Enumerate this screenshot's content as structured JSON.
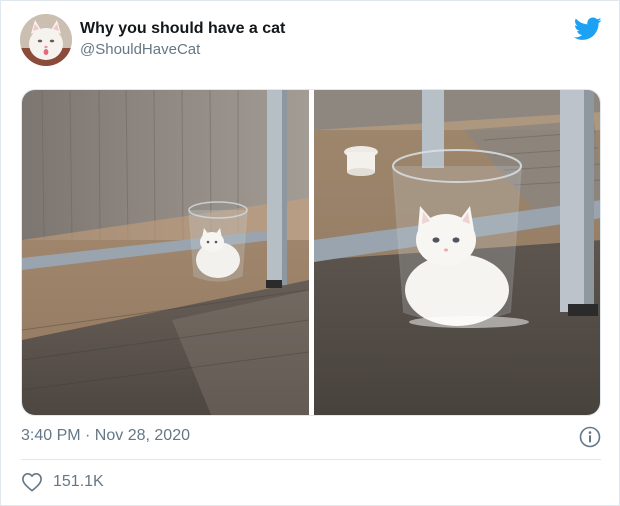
{
  "tweet": {
    "display_name": "Why you should have a cat",
    "handle": "@ShouldHaveCat",
    "timestamp": "3:40 PM · Nov 28, 2020",
    "like_count": "151.1K"
  },
  "icons": {
    "brand": "twitter-bird-icon",
    "info": "info-icon",
    "like": "heart-icon"
  },
  "colors": {
    "twitter_blue": "#1da1f2",
    "secondary_text": "#657786",
    "divider": "#e1e8ed"
  }
}
